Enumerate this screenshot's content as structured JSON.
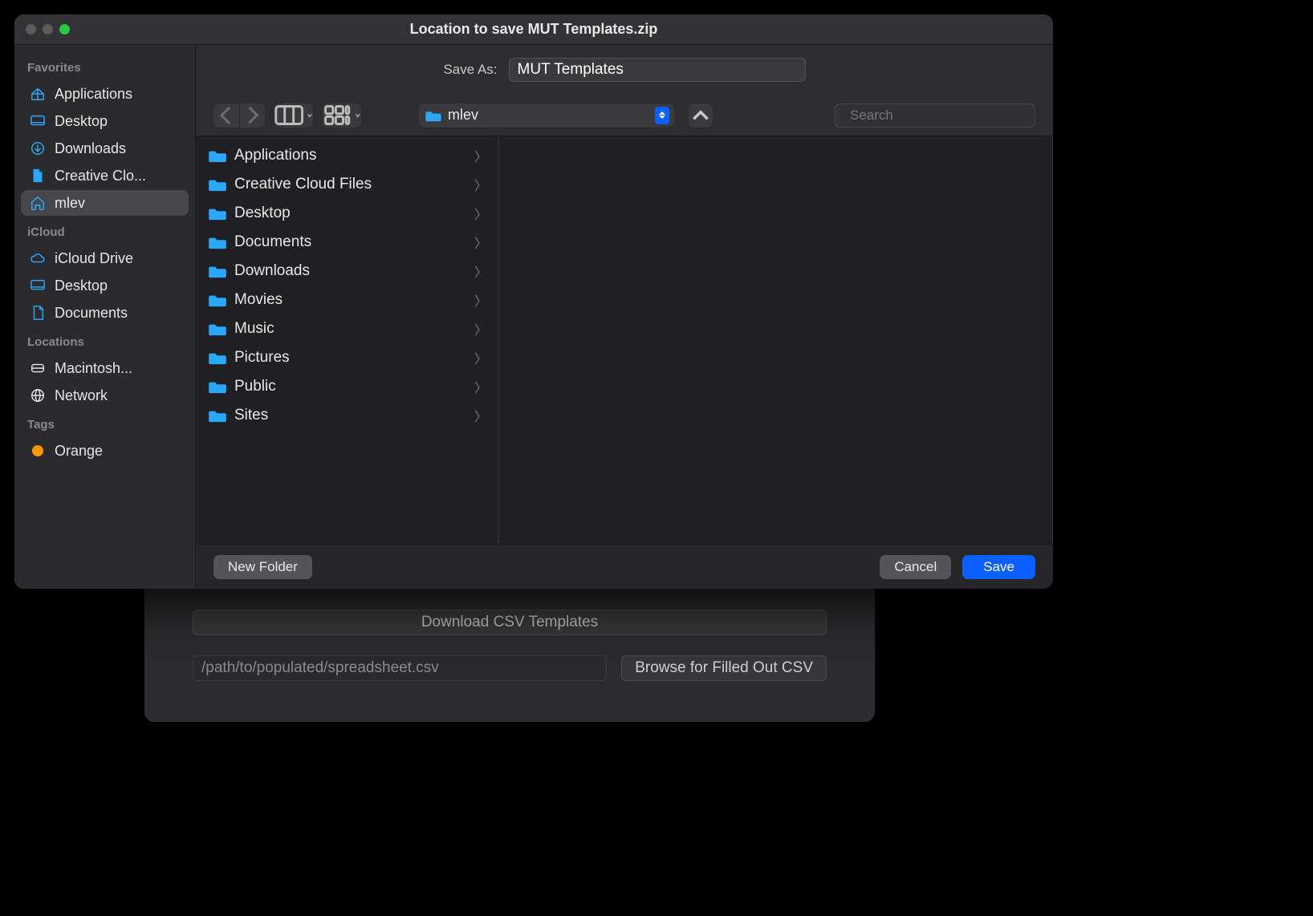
{
  "dialog": {
    "title": "Location to save MUT Templates.zip",
    "save_as_label": "Save As:",
    "save_as_value": "MUT Templates",
    "location_selected": "mlev",
    "search_placeholder": "Search",
    "new_folder_label": "New Folder",
    "cancel_label": "Cancel",
    "save_label": "Save"
  },
  "sidebar": {
    "sections": [
      {
        "label": "Favorites",
        "items": [
          {
            "icon": "apps",
            "label": "Applications",
            "selected": false
          },
          {
            "icon": "desktop",
            "label": "Desktop",
            "selected": false
          },
          {
            "icon": "download",
            "label": "Downloads",
            "selected": false
          },
          {
            "icon": "file",
            "label": "Creative Clo...",
            "selected": false
          },
          {
            "icon": "home",
            "label": "mlev",
            "selected": true
          }
        ]
      },
      {
        "label": "iCloud",
        "items": [
          {
            "icon": "cloud",
            "label": "iCloud Drive",
            "selected": false
          },
          {
            "icon": "desktop",
            "label": "Desktop",
            "selected": false
          },
          {
            "icon": "doc",
            "label": "Documents",
            "selected": false
          }
        ]
      },
      {
        "label": "Locations",
        "items": [
          {
            "icon": "disk",
            "label": "Macintosh...",
            "selected": false
          },
          {
            "icon": "globe",
            "label": "Network",
            "selected": false
          }
        ]
      },
      {
        "label": "Tags",
        "items": [
          {
            "icon": "tag-orange",
            "label": "Orange",
            "selected": false
          }
        ]
      }
    ]
  },
  "folders": [
    "Applications",
    "Creative Cloud Files",
    "Desktop",
    "Documents",
    "Downloads",
    "Movies",
    "Music",
    "Pictures",
    "Public",
    "Sites"
  ],
  "background_window": {
    "download_button": "Download CSV Templates",
    "path_placeholder": "/path/to/populated/spreadsheet.csv",
    "browse_button": "Browse for Filled Out CSV"
  }
}
